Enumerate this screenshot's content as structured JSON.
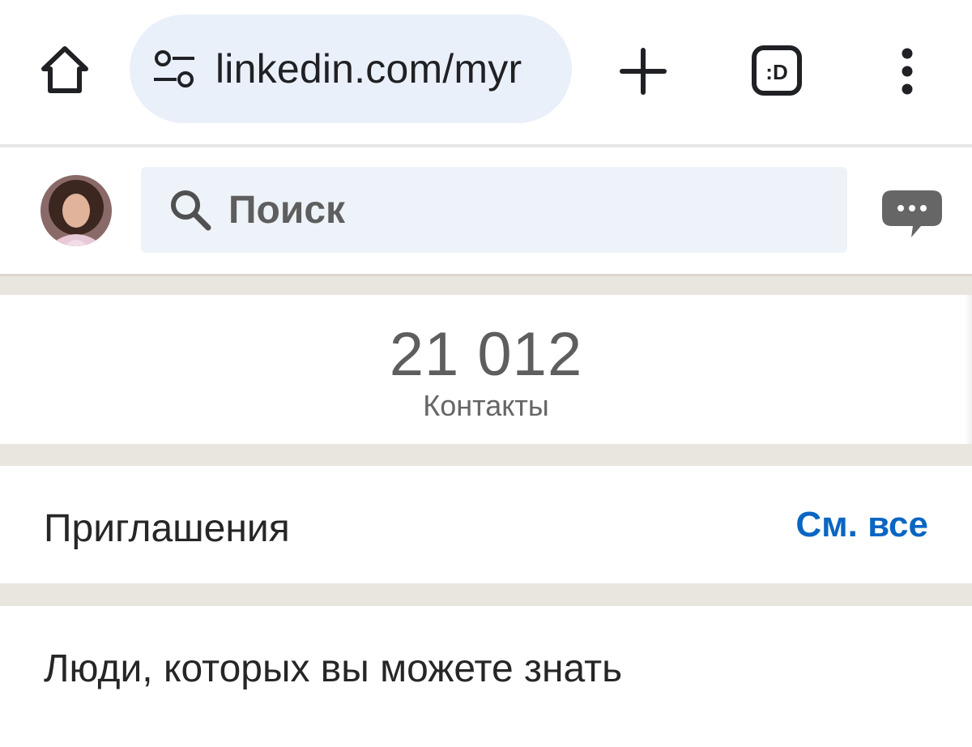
{
  "browser": {
    "url": "linkedin.com/myr",
    "icons": {
      "home": "home-icon",
      "site_settings": "tune-icon",
      "new_tab": "plus-icon",
      "tabs": "tab-switcher-icon",
      "menu": "more-vert-icon"
    },
    "tab_switcher_text": ":D"
  },
  "header": {
    "search_placeholder": "Поиск",
    "icons": {
      "search": "search-icon",
      "messaging": "messaging-icon",
      "avatar": "avatar"
    }
  },
  "contacts": {
    "count": "21 012",
    "label": "Контакты"
  },
  "invitations": {
    "title": "Приглашения",
    "see_all": "См. все"
  },
  "people_you_may_know": {
    "title": "Люди, которых вы можете знать"
  },
  "colors": {
    "link_blue": "#0a66c2",
    "omnibox_bg": "#eaf0fa",
    "search_bg": "#edf3f8",
    "section_gap": "#e9e5df"
  }
}
